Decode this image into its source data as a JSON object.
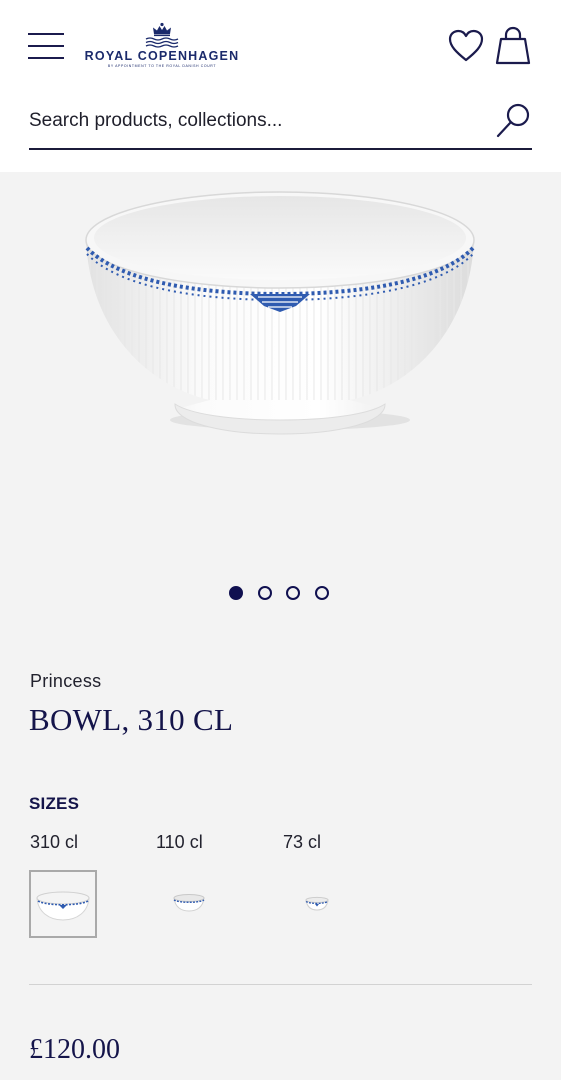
{
  "header": {
    "brand_name": "ROYAL COPENHAGEN",
    "brand_tagline": "BY APPOINTMENT TO THE ROYAL DANISH COURT"
  },
  "search": {
    "placeholder": "Search products, collections..."
  },
  "gallery": {
    "image_count": 4,
    "active_index": 0
  },
  "product": {
    "collection": "Princess",
    "title": "BOWL, 310 CL",
    "sizes_heading": "SIZES",
    "sizes": [
      {
        "label": "310 cl",
        "selected": true
      },
      {
        "label": "110 cl",
        "selected": false
      },
      {
        "label": "73 cl",
        "selected": false
      }
    ],
    "price": "£120.00"
  },
  "colors": {
    "brand_navy": "#14144a",
    "pattern_blue": "#2f5bb0",
    "background_gray": "#f3f3f3"
  },
  "icons": {
    "menu": "hamburger-menu-icon",
    "wishlist": "heart-icon",
    "bag": "shopping-bag-icon",
    "search": "search-icon"
  }
}
